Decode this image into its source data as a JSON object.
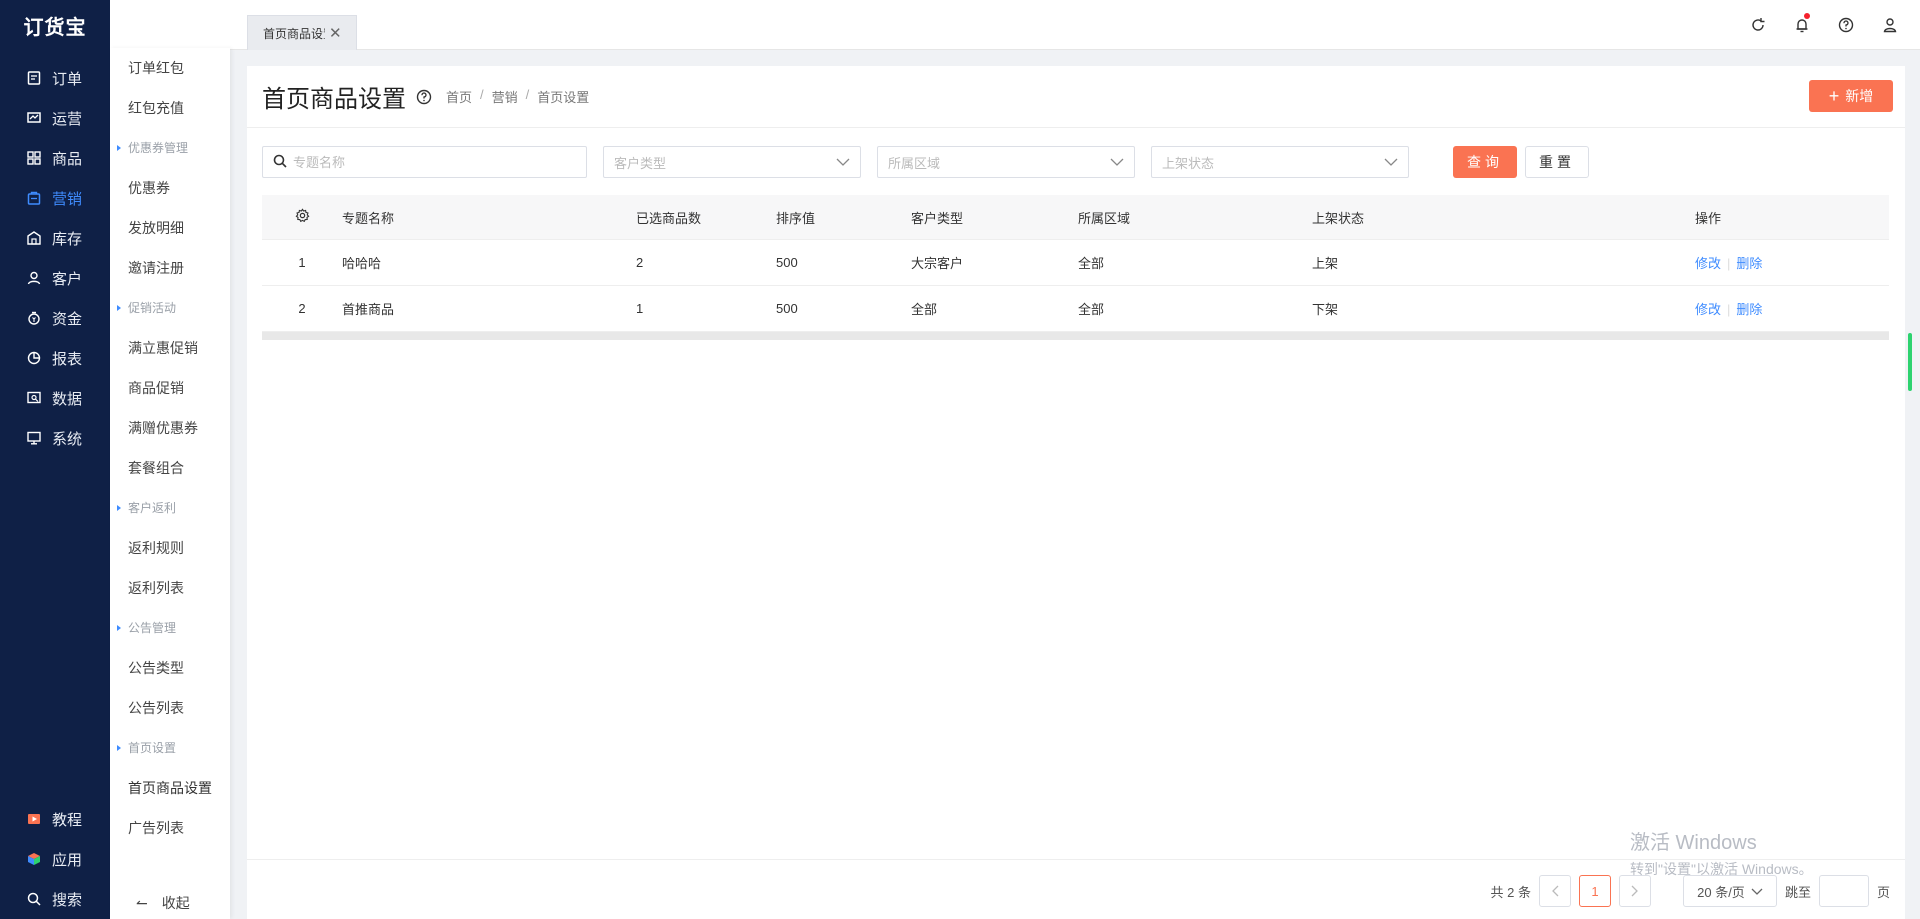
{
  "app": {
    "logo": "订货宝"
  },
  "nav": {
    "items": [
      {
        "label": "订单",
        "icon": "order-icon"
      },
      {
        "label": "运营",
        "icon": "operation-icon"
      },
      {
        "label": "商品",
        "icon": "goods-icon"
      },
      {
        "label": "营销",
        "icon": "marketing-icon",
        "active": true
      },
      {
        "label": "库存",
        "icon": "warehouse-icon"
      },
      {
        "label": "客户",
        "icon": "user-icon"
      },
      {
        "label": "资金",
        "icon": "money-icon"
      },
      {
        "label": "报表",
        "icon": "pie-chart-icon"
      },
      {
        "label": "数据",
        "icon": "data-icon"
      },
      {
        "label": "系统",
        "icon": "monitor-icon"
      }
    ],
    "bottom": [
      {
        "label": "教程",
        "icon": "video-icon"
      },
      {
        "label": "应用",
        "icon": "app-cube-icon"
      },
      {
        "label": "搜索",
        "icon": "search-icon"
      }
    ]
  },
  "subnav": {
    "items": [
      {
        "type": "item",
        "label": "订单红包"
      },
      {
        "type": "item",
        "label": "红包充值"
      },
      {
        "type": "group",
        "label": "优惠券管理"
      },
      {
        "type": "item",
        "label": "优惠券"
      },
      {
        "type": "item",
        "label": "发放明细"
      },
      {
        "type": "item",
        "label": "邀请注册"
      },
      {
        "type": "group",
        "label": "促销活动"
      },
      {
        "type": "item",
        "label": "满立惠促销"
      },
      {
        "type": "item",
        "label": "商品促销"
      },
      {
        "type": "item",
        "label": "满赠优惠券"
      },
      {
        "type": "item",
        "label": "套餐组合"
      },
      {
        "type": "group",
        "label": "客户返利"
      },
      {
        "type": "item",
        "label": "返利规则"
      },
      {
        "type": "item",
        "label": "返利列表"
      },
      {
        "type": "group",
        "label": "公告管理"
      },
      {
        "type": "item",
        "label": "公告类型"
      },
      {
        "type": "item",
        "label": "公告列表"
      },
      {
        "type": "group",
        "label": "首页设置"
      },
      {
        "type": "item",
        "label": "首页商品设置",
        "active": true
      },
      {
        "type": "item",
        "label": "广告列表"
      }
    ],
    "collapse_label": "收起"
  },
  "topbar": {
    "tab_label": "首页商品设置"
  },
  "page": {
    "title": "首页商品设置",
    "breadcrumb": [
      "首页",
      "营销",
      "首页设置"
    ],
    "add_label": "新增"
  },
  "filters": {
    "search_placeholder": "专题名称",
    "customer_type": "客户类型",
    "region": "所属区域",
    "status": "上架状态",
    "query_label": "查询",
    "reset_label": "重置"
  },
  "table": {
    "headers": [
      "专题名称",
      "已选商品数",
      "排序值",
      "客户类型",
      "所属区域",
      "上架状态",
      "操作"
    ],
    "rows": [
      {
        "index": "1",
        "name": "哈哈哈",
        "count": "2",
        "sort": "500",
        "customer": "大宗客户",
        "region": "全部",
        "status": "上架"
      },
      {
        "index": "2",
        "name": "首推商品",
        "count": "1",
        "sort": "500",
        "customer": "全部",
        "region": "全部",
        "status": "下架"
      }
    ],
    "edit_label": "修改",
    "delete_label": "删除"
  },
  "pager": {
    "total": "共 2 条",
    "current": "1",
    "page_size": "20 条/页",
    "jump_label": "跳至",
    "page_unit": "页"
  },
  "watermark": {
    "line1": "激活 Windows",
    "line2": "转到\"设置\"以激活 Windows。"
  },
  "colors": {
    "accent": "#fa7352",
    "nav_bg": "#0f2046",
    "link": "#3f8cff"
  }
}
